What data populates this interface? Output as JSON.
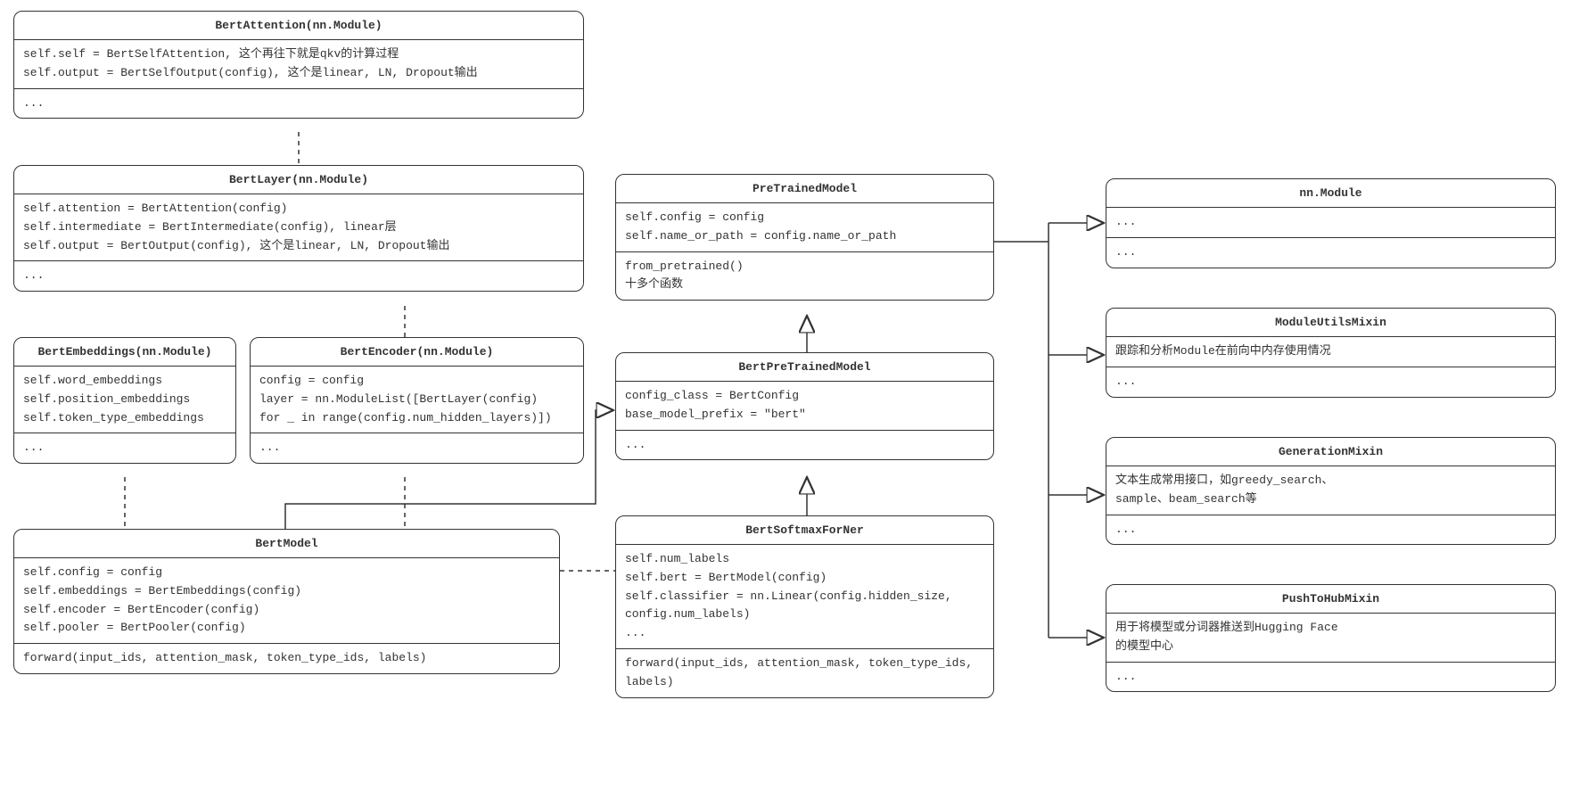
{
  "classes": {
    "bertAttention": {
      "title": "BertAttention(nn.Module)",
      "attrs": "self.self = BertSelfAttention, 这个再往下就是qkv的计算过程\nself.output = BertSelfOutput(config), 这个是linear, LN, Dropout输出",
      "methods": "..."
    },
    "bertLayer": {
      "title": "BertLayer(nn.Module)",
      "attrs": "self.attention = BertAttention(config)\nself.intermediate = BertIntermediate(config), linear层\nself.output = BertOutput(config), 这个是linear, LN, Dropout输出",
      "methods": "..."
    },
    "bertEmbeddings": {
      "title": "BertEmbeddings(nn.Module)",
      "attrs": "self.word_embeddings\nself.position_embeddings\nself.token_type_embeddings",
      "methods": "..."
    },
    "bertEncoder": {
      "title": "BertEncoder(nn.Module)",
      "attrs": "config = config\nlayer = nn.ModuleList([BertLayer(config)\nfor _ in range(config.num_hidden_layers)])",
      "methods": "..."
    },
    "bertModel": {
      "title": "BertModel",
      "attrs": "self.config = config\nself.embeddings = BertEmbeddings(config)\nself.encoder = BertEncoder(config)\nself.pooler = BertPooler(config)",
      "methods": "forward(input_ids, attention_mask, token_type_ids, labels)"
    },
    "preTrainedModel": {
      "title": "PreTrainedModel",
      "attrs": "self.config = config\nself.name_or_path = config.name_or_path",
      "methods": "from_pretrained()\n十多个函数"
    },
    "bertPreTrainedModel": {
      "title": "BertPreTrainedModel",
      "attrs": "config_class = BertConfig\nbase_model_prefix = \"bert\"",
      "methods": "..."
    },
    "bertSoftmaxForNer": {
      "title": "BertSoftmaxForNer",
      "attrs": "self.num_labels\nself.bert = BertModel(config)\nself.classifier = nn.Linear(config.hidden_size,\nconfig.num_labels)\n...",
      "methods": "forward(input_ids, attention_mask, token_type_ids,\nlabels)"
    },
    "nnModule": {
      "title": "nn.Module",
      "attrs": "...",
      "methods": "..."
    },
    "moduleUtilsMixin": {
      "title": "ModuleUtilsMixin",
      "attrs": "跟踪和分析Module在前向中内存使用情况",
      "methods": "..."
    },
    "generationMixin": {
      "title": "GenerationMixin",
      "attrs": "文本生成常用接口，如greedy_search、\nsample、beam_search等",
      "methods": "..."
    },
    "pushToHubMixin": {
      "title": "PushToHubMixin",
      "attrs": "用于将模型或分词器推送到Hugging Face\n的模型中心",
      "methods": "..."
    }
  }
}
